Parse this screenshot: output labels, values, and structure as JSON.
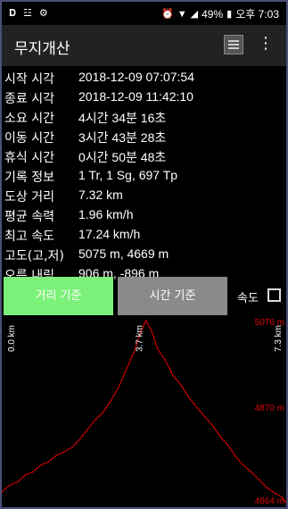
{
  "statusbar": {
    "icons_left": [
      "sync-icon",
      "usb-icon",
      "android-debug-icon"
    ],
    "battery": "49%",
    "time": "오후 7:03"
  },
  "appbar": {
    "title": "무지개산"
  },
  "info_rows": [
    {
      "label": "시작 시각",
      "value": "2018-12-09 07:07:54"
    },
    {
      "label": "종료 시각",
      "value": "2018-12-09 11:42:10"
    },
    {
      "label": "소요 시간",
      "value": "4시간 34분 16초"
    },
    {
      "label": "이동 시간",
      "value": "3시간 43분 28초"
    },
    {
      "label": "휴식 시간",
      "value": "0시간 50분 48초"
    },
    {
      "label": "기록 정보",
      "value": "1 Tr, 1 Sg, 697 Tp"
    },
    {
      "label": "도상 거리",
      "value": "7.32 km"
    },
    {
      "label": "평균 속력",
      "value": "1.96 km/h"
    },
    {
      "label": "최고 속도",
      "value": "17.24 km/h"
    },
    {
      "label": "고도(고,저)",
      "value": "5075 m, 4669 m"
    },
    {
      "label": "오름,내림",
      "value": "906 m, -896 m"
    }
  ],
  "buttons": {
    "distance": "거리 기준",
    "time": "시간 기준",
    "speed_label": "속도"
  },
  "chart_data": {
    "type": "line",
    "x_unit": "km",
    "y_unit": "m",
    "xlim": [
      0.0,
      7.3
    ],
    "ylim": [
      4664,
      5076
    ],
    "x_tick_labels": [
      "0.0 km",
      "3.7 km",
      "7.3 km"
    ],
    "y_tick_labels": [
      "5076 m",
      "4870 m",
      "4664 m"
    ],
    "line_color": "#cc0000",
    "series": [
      {
        "x": [
          0.0,
          0.2,
          0.4,
          0.6,
          0.8,
          1.0,
          1.2,
          1.4,
          1.6,
          1.8,
          2.0,
          2.2,
          2.4,
          2.6,
          2.8,
          3.0,
          3.2,
          3.4,
          3.55,
          3.7,
          3.85,
          4.0,
          4.2,
          4.4,
          4.6,
          4.8,
          5.0,
          5.2,
          5.4,
          5.6,
          5.8,
          6.0,
          6.2,
          6.4,
          6.6,
          6.8,
          7.0,
          7.2,
          7.3
        ],
        "y": [
          4690,
          4705,
          4712,
          4728,
          4735,
          4750,
          4758,
          4772,
          4780,
          4790,
          4808,
          4830,
          4852,
          4868,
          4895,
          4925,
          4965,
          5005,
          5045,
          5074,
          5050,
          5010,
          4985,
          4950,
          4930,
          4902,
          4880,
          4860,
          4840,
          4815,
          4795,
          4770,
          4750,
          4735,
          4718,
          4700,
          4688,
          4678,
          4666
        ]
      }
    ]
  }
}
